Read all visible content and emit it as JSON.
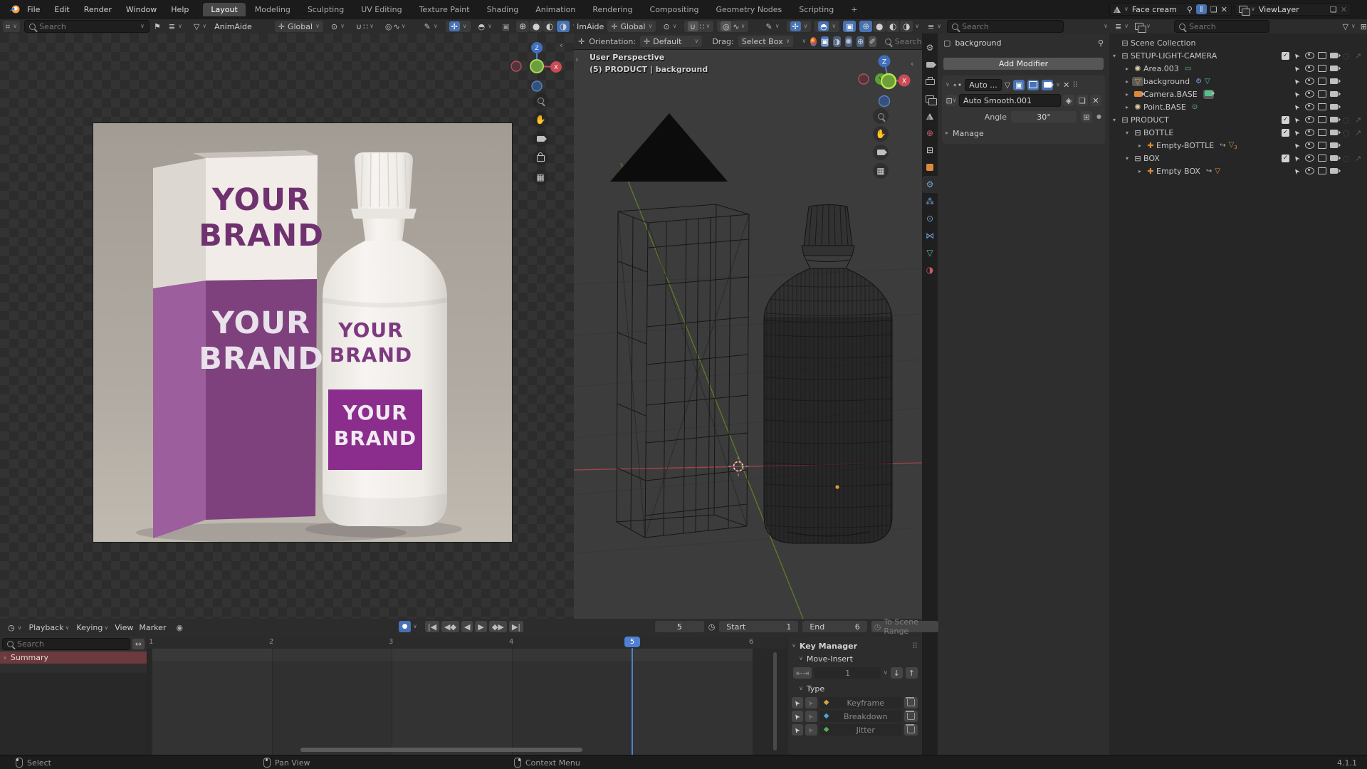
{
  "topbar": {
    "menus": [
      "File",
      "Edit",
      "Render",
      "Window",
      "Help"
    ],
    "workspaces": [
      "Layout",
      "Modeling",
      "Sculpting",
      "UV Editing",
      "Texture Paint",
      "Shading",
      "Animation",
      "Rendering",
      "Compositing",
      "Geometry Nodes",
      "Scripting"
    ],
    "active_workspace": "Layout",
    "add_tab": "+",
    "scene_name": "Face cream",
    "view_layer": "ViewLayer"
  },
  "left_header": {
    "search_placeholder": "Search",
    "addon": "AnimAide",
    "orientation": "Global"
  },
  "right_header": {
    "addon": "ImAide",
    "orientation": "Global"
  },
  "tool_settings": {
    "orientation_label": "Orientation:",
    "orientation_value": "Default",
    "drag_label": "Drag:",
    "drag_value": "Select Box",
    "search_placeholder": "Search"
  },
  "viewport": {
    "view_label": "User Perspective",
    "context_label": "(5) PRODUCT | background",
    "axis_z": "Z",
    "axis_y": "Y",
    "axis_x": "X"
  },
  "render": {
    "box_top_line1": "YOUR",
    "box_top_line2": "BRAND",
    "box_bottom_line1": "YOUR",
    "box_bottom_line2": "BRAND",
    "bottle_top_line1": "YOUR",
    "bottle_top_line2": "BRAND",
    "bottle_label_line1": "YOUR",
    "bottle_label_line2": "BRAND"
  },
  "properties": {
    "header_search_placeholder": "Search",
    "breadcrumb": "background",
    "add_modifier_label": "Add Modifier",
    "modifier_name_short": "Auto ...",
    "node_group_name": "Auto Smooth.001",
    "angle_label": "Angle",
    "angle_value": "30°",
    "manage_label": "Manage"
  },
  "outliner": {
    "search_placeholder": "Search",
    "items": [
      {
        "label": "Scene Collection"
      },
      {
        "label": "SETUP-LIGHT-CAMERA"
      },
      {
        "label": "Area.003"
      },
      {
        "label": "background"
      },
      {
        "label": "Camera.BASE"
      },
      {
        "label": "Point.BASE"
      },
      {
        "label": "PRODUCT"
      },
      {
        "label": "BOTTLE"
      },
      {
        "label": "Empty-BOTTLE",
        "badge_count": "3"
      },
      {
        "label": "BOX"
      },
      {
        "label": "Empty BOX"
      }
    ]
  },
  "timeline": {
    "menus": [
      "Playback",
      "Keying",
      "View",
      "Marker"
    ],
    "current_frame": "5",
    "start_label": "Start",
    "start_value": "1",
    "end_label": "End",
    "end_value": "6",
    "to_scene_range_label": "To Scene Range",
    "search_placeholder": "Search",
    "summary_label": "Summary",
    "frames": [
      "1",
      "2",
      "3",
      "4",
      "5",
      "6"
    ],
    "playhead": "5"
  },
  "key_manager": {
    "title": "Key Manager",
    "move_insert_label": "Move-Insert",
    "amount_value": "1",
    "type_label": "Type",
    "types": [
      {
        "label": "Keyframe",
        "color": "#d8a63a"
      },
      {
        "label": "Breakdown",
        "color": "#4aa3e0"
      },
      {
        "label": "Jitter",
        "color": "#52b052"
      }
    ]
  },
  "status_bar": {
    "items": [
      "Select",
      "Pan View",
      "Context Menu"
    ],
    "version": "4.1.1"
  },
  "colors": {
    "accent_blue": "#4772b3",
    "playhead_blue": "#4f80d2",
    "purple_box_front": "#7e417e",
    "purple_box_side": "#9c5e9c",
    "purple_label": "#8a2d8c",
    "keyframe_orange": "#d8a63a",
    "summary_red": "#6a3a3c"
  }
}
